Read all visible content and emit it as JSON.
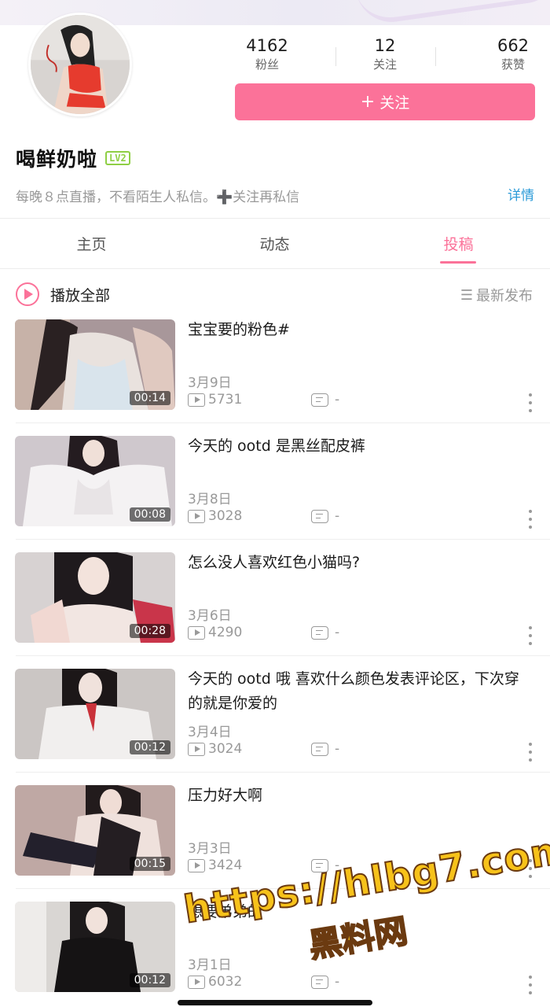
{
  "profile": {
    "username": "喝鲜奶啦",
    "level": "LV2",
    "bio": "每晚８点直播，不看陌生人私信。➕关注再私信",
    "detail_link": "详情",
    "follow_button": "关注",
    "stats": [
      {
        "value": "4162",
        "label": "粉丝"
      },
      {
        "value": "12",
        "label": "关注"
      },
      {
        "value": "662",
        "label": "获赞"
      }
    ]
  },
  "tabs": [
    {
      "label": "主页",
      "active": false
    },
    {
      "label": "动态",
      "active": false
    },
    {
      "label": "投稿",
      "active": true
    }
  ],
  "list_header": {
    "play_all": "播放全部",
    "sort": "最新发布"
  },
  "videos": [
    {
      "title": "宝宝要的粉色#",
      "date": "3月9日",
      "plays": "5731",
      "comments": "-",
      "duration": "00:14"
    },
    {
      "title": "今天的 ootd 是黑丝配皮裤",
      "date": "3月8日",
      "plays": "3028",
      "comments": "-",
      "duration": "00:08"
    },
    {
      "title": "怎么没人喜欢红色小猫吗?",
      "date": "3月6日",
      "plays": "4290",
      "comments": "-",
      "duration": "00:28"
    },
    {
      "title": "今天的 ootd 哦 喜欢什么颜色发表评论区，下次穿的就是你爱的",
      "date": "3月4日",
      "plays": "3024",
      "comments": "-",
      "duration": "00:12"
    },
    {
      "title": "压力好大啊",
      "date": "3月3日",
      "plays": "3424",
      "comments": "-",
      "duration": "00:15"
    },
    {
      "title": "想要弟弟的",
      "date": "3月1日",
      "plays": "6032",
      "comments": "-",
      "duration": "00:12"
    }
  ],
  "watermark": {
    "url": "https://hlbg7.com",
    "label": "黑料网"
  },
  "colors": {
    "accent": "#fb7299",
    "link": "#2b9bd8",
    "level_badge": "#8fcf45",
    "muted_text": "#999999"
  }
}
